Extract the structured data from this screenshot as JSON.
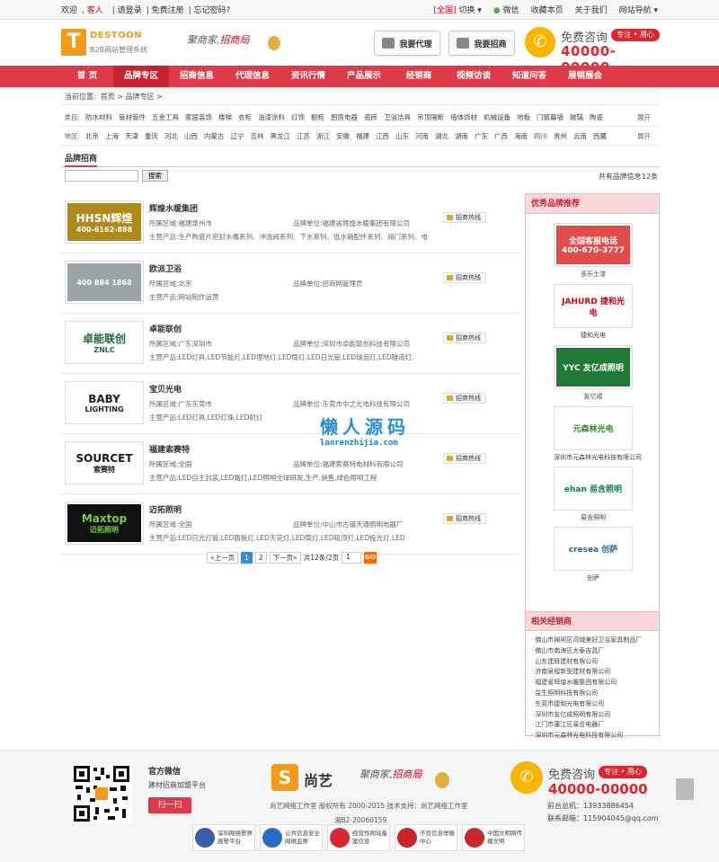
{
  "topbar": {
    "welcome": "欢迎",
    "guest": "客人",
    "login": "请登录",
    "register": "免费注册",
    "forgot": "忘记密码?",
    "region": "[全国]",
    "switch": "切换",
    "wechat": "微信",
    "favorite": "收藏本页",
    "about": "关于我们",
    "sitenav": "网站导航"
  },
  "header": {
    "logo_text": "DESTOON",
    "logo_sub": "B2B网站管理系统",
    "slogan_a": "聚商家,",
    "slogan_b": "招商局",
    "btn_agent": "我要代理",
    "btn_invest": "我要招商",
    "consult": "免费咨询",
    "pill": "专注 • 用心",
    "phone": "40000-00000"
  },
  "nav": [
    {
      "label": "首 页",
      "w": 58
    },
    {
      "label": "品牌专区",
      "w": 62,
      "active": true
    },
    {
      "label": "招商信息",
      "w": 62
    },
    {
      "label": "代理信息",
      "w": 62
    },
    {
      "label": "资讯行情",
      "w": 62
    },
    {
      "label": "产品展示",
      "w": 62
    },
    {
      "label": "经销商",
      "w": 60
    },
    {
      "label": "视频访谈",
      "w": 62
    },
    {
      "label": "知道问答",
      "w": 62
    },
    {
      "label": "展销展会",
      "w": 62
    }
  ],
  "breadcrumb": {
    "label": "当前位置:",
    "home": "首页",
    "current": "品牌专区"
  },
  "filter": {
    "cat_label": "类目:",
    "cats": [
      "防水材料",
      "管材管件",
      "五金工具",
      "家居装饰",
      "楼梯",
      "衣柜",
      "油漆涂料",
      "灯饰",
      "橱柜",
      "厨房电器",
      "瓷砖",
      "卫浴洁具",
      "吊顶隔断",
      "墙体饰材",
      "机械设备",
      "地板",
      "门窗幕墙",
      "玻璃",
      "陶瓷"
    ],
    "area_label": "地区:",
    "areas": [
      "北京",
      "上海",
      "天津",
      "重庆",
      "河北",
      "山西",
      "内蒙古",
      "辽宁",
      "吉林",
      "黑龙江",
      "江苏",
      "浙江",
      "安徽",
      "福建",
      "江西",
      "山东",
      "河南",
      "湖北",
      "湖南",
      "广东",
      "广西",
      "海南",
      "四川",
      "贵州",
      "云南",
      "西藏"
    ],
    "more": "展开"
  },
  "section": {
    "title": "品牌招商",
    "search_btn": "搜索",
    "total": "共有品牌信息12条"
  },
  "brands": [
    {
      "name": "辉煌水暖集团",
      "area_label": "所属区域:",
      "area": "福建泉州市",
      "unit_label": "品牌单位:",
      "unit": "福建省辉煌水暖集团有限公司",
      "prod_label": "主营产品:",
      "products": "生产陶瓷片密封水嘴系列、冲洗阀系列、下水系列、低水箱配件系列、阀门系列、电",
      "hot": "招商热线",
      "logo_text": "HHSN辉煌",
      "logo_sub": "400-6162-888",
      "bg": "#b0891b",
      "fg": "#fff"
    },
    {
      "name": "欧派卫浴",
      "area_label": "所属区域:",
      "area": "北京",
      "unit_label": "品牌单位:",
      "unit": "招商网管理员",
      "prod_label": "主营产品:",
      "products": "网站制作运营",
      "hot": "招商热线",
      "logo_text": "",
      "logo_sub": "400 884 1868",
      "bg": "#9aa3a6",
      "fg": "#fff"
    },
    {
      "name": "卓能联创",
      "area_label": "所属区域:",
      "area": "广东深圳市",
      "unit_label": "品牌单位:",
      "unit": "深圳市卓能联创科技有限公司",
      "prod_label": "主营产品:",
      "products": "LED灯具,LED节能灯,LED埋地灯,LED筒灯,LED日光管,LED球泡灯,LED隧道灯,",
      "hot": "招商热线",
      "logo_text": "卓能联创",
      "logo_sub": "ZNLC",
      "bg": "#fff",
      "fg": "#1e6b3a"
    },
    {
      "name": "宝贝光电",
      "area_label": "所属区域:",
      "area": "广东东莞市",
      "unit_label": "品牌单位:",
      "unit": "东莞市中之光电科技有限公司",
      "prod_label": "主营产品:",
      "products": "LED灯具,LED灯珠,LED射灯",
      "hot": "招商热线",
      "logo_text": "BABY",
      "logo_sub": "LIGHTING",
      "bg": "#fff",
      "fg": "#222"
    },
    {
      "name": "福建索赛特",
      "area_label": "所属区域:",
      "area": "全国",
      "unit_label": "品牌单位:",
      "unit": "福建索赛特电材料有限公司",
      "prod_label": "主营产品:",
      "products": "LED自主封装,LED路灯,LED照明全球研发,生产,销售,绿色照明工程",
      "hot": "招商热线",
      "logo_text": "SOURCET",
      "logo_sub": "索赛特",
      "bg": "#fff",
      "fg": "#1a1a1a"
    },
    {
      "name": "迈拓照明",
      "area_label": "所属区域:",
      "area": "全国",
      "unit_label": "品牌单位:",
      "unit": "中山市古镇天通照明电器厂",
      "prod_label": "主营产品:",
      "products": "LED日光灯管,LED面板灯,LED天花灯,LED筒灯,LED吸顶灯,LED投光灯,LED",
      "hot": "招商热线",
      "logo_text": "Maxtop",
      "logo_sub": "迈拓照明",
      "bg": "#111",
      "fg": "#7ac943"
    }
  ],
  "pager": {
    "prev": "«上一页",
    "p1": "1",
    "p2": "2",
    "next": "下一页»",
    "info": "共12条/2页",
    "input": "1",
    "go": "GO"
  },
  "watermark": {
    "cn": "懒人源码",
    "py": "lanrenzhijia.com"
  },
  "sidebar": {
    "brands_title": "优秀品牌推荐",
    "brands": [
      {
        "name": "多乐士漆",
        "text": "全国客服电话 400-670-3777",
        "bg": "#e34b4b",
        "fg": "#fff"
      },
      {
        "name": "捷和光电",
        "text": "JAHURD 捷和光电",
        "bg": "#fff",
        "fg": "#d8000f"
      },
      {
        "name": "友亿成",
        "text": "YYC 友亿成照明",
        "bg": "#1e7a34",
        "fg": "#fff"
      },
      {
        "name": "深圳市元森林光电科技有限公司",
        "text": "元森林光电",
        "bg": "#fff",
        "fg": "#2a8a2a"
      },
      {
        "name": "易含照明",
        "text": "ehan 易含照明",
        "bg": "#fff",
        "fg": "#0a7a5a"
      },
      {
        "name": "创萨",
        "text": "cresea 创萨",
        "bg": "#fff",
        "fg": "#1a6db5"
      }
    ],
    "dealers_title": "相关经销商",
    "dealers": [
      "佛山市禅阿区湾城美好卫浴家具制品厂",
      "佛山市南海区大泰吉具厂",
      "山东建辉建材有限公司",
      "济南泉程新型建材有限公司",
      "福建省辉煌水暖集团有限公司",
      "益生照明科技有限公司",
      "东莞市捷和光电有限公司",
      "深圳市友亿成照明有限公司",
      "江门市蓬江区易合电器厂",
      "深圳市元森林光电科技有限公司"
    ]
  },
  "footer": {
    "wx_title": "官方微信",
    "wx_sub": "建材招商加盟平台",
    "scan": "扫一扫",
    "logo_s": "S",
    "logo_name": "尚艺",
    "copyright": "尚艺网络工作室 版权所有 2000-2015 技术支持：尚艺网络工作室",
    "icp": "湘B2-20060159",
    "badges": [
      {
        "text": "深圳网络警察报警平台",
        "c": "#3a5fa8"
      },
      {
        "text": "公共信息安全网络监察",
        "c": "#2b6cc4"
      },
      {
        "text": "经营性网站备案信息",
        "c": "#d8282e"
      },
      {
        "text": "不良信息举报中心",
        "c": "#c9242b"
      },
      {
        "text": "中国文明网传播文明",
        "c": "#c8282c"
      }
    ],
    "consult": "免费咨询",
    "pill": "专注 • 用心",
    "phone": "40000-00000",
    "tel_label": "前台总机：",
    "tel": "13933886454",
    "mail_label": "联系邮箱：",
    "mail": "115904045@qq.com"
  }
}
